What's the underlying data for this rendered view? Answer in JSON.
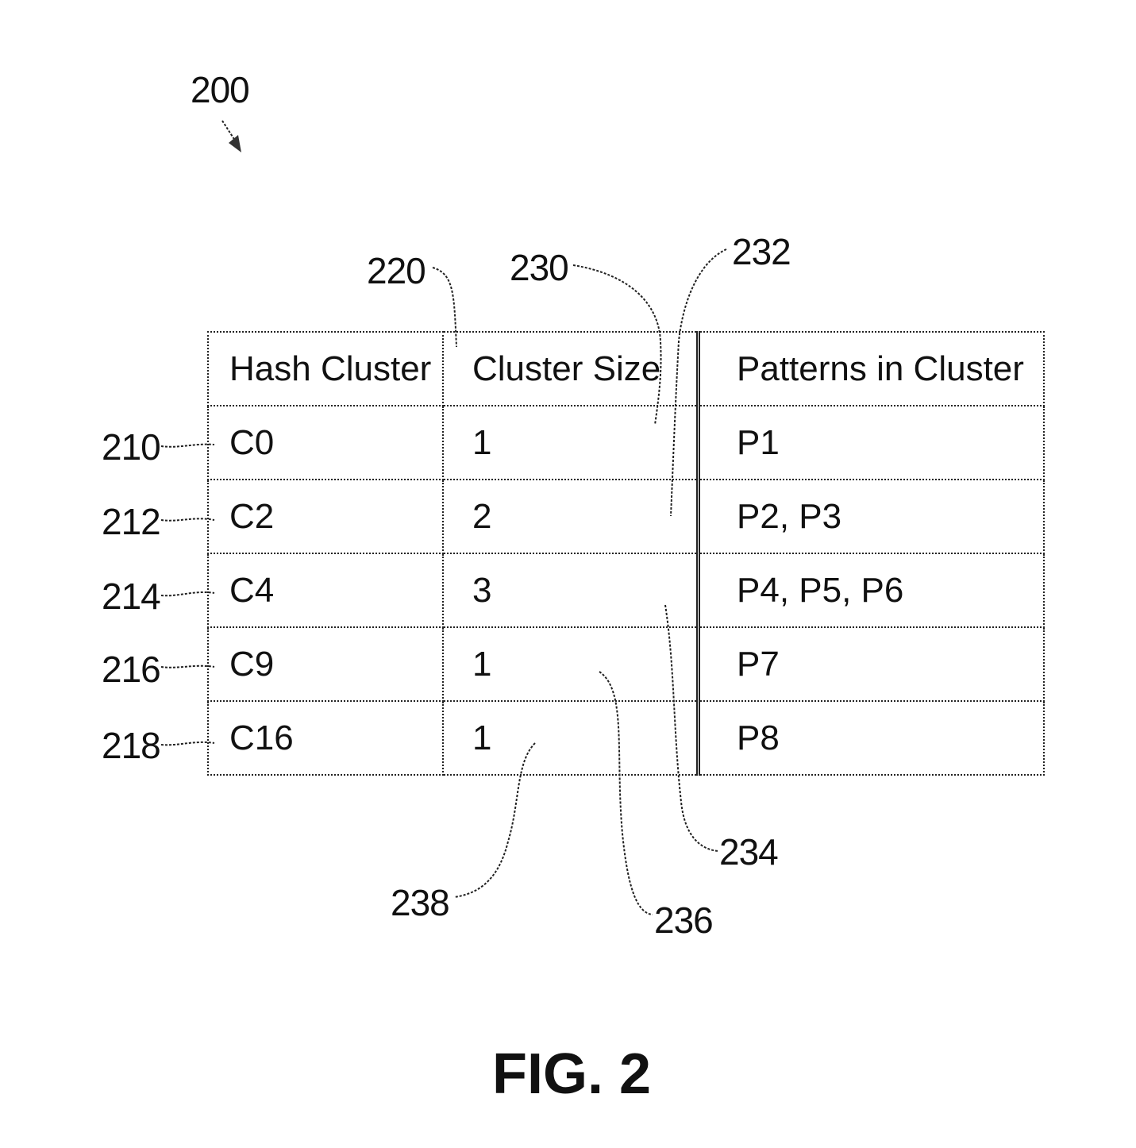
{
  "figure": {
    "ref": "200",
    "caption": "FIG. 2"
  },
  "table": {
    "ref": "220",
    "headers": [
      "Hash Cluster",
      "Cluster Size",
      "Patterns in Cluster"
    ],
    "rows": [
      {
        "ref": "210",
        "cluster": "C0",
        "size": "1",
        "patterns": "P1"
      },
      {
        "ref": "212",
        "cluster": "C2",
        "size": "2",
        "patterns": "P2, P3"
      },
      {
        "ref": "214",
        "cluster": "C4",
        "size": "3",
        "patterns": "P4, P5, P6"
      },
      {
        "ref": "216",
        "cluster": "C9",
        "size": "1",
        "patterns": "P7"
      },
      {
        "ref": "218",
        "cluster": "C16",
        "size": "1",
        "patterns": "P8"
      }
    ]
  },
  "callouts": {
    "r230": "230",
    "r232": "232",
    "r234": "234",
    "r236": "236",
    "r238": "238"
  }
}
